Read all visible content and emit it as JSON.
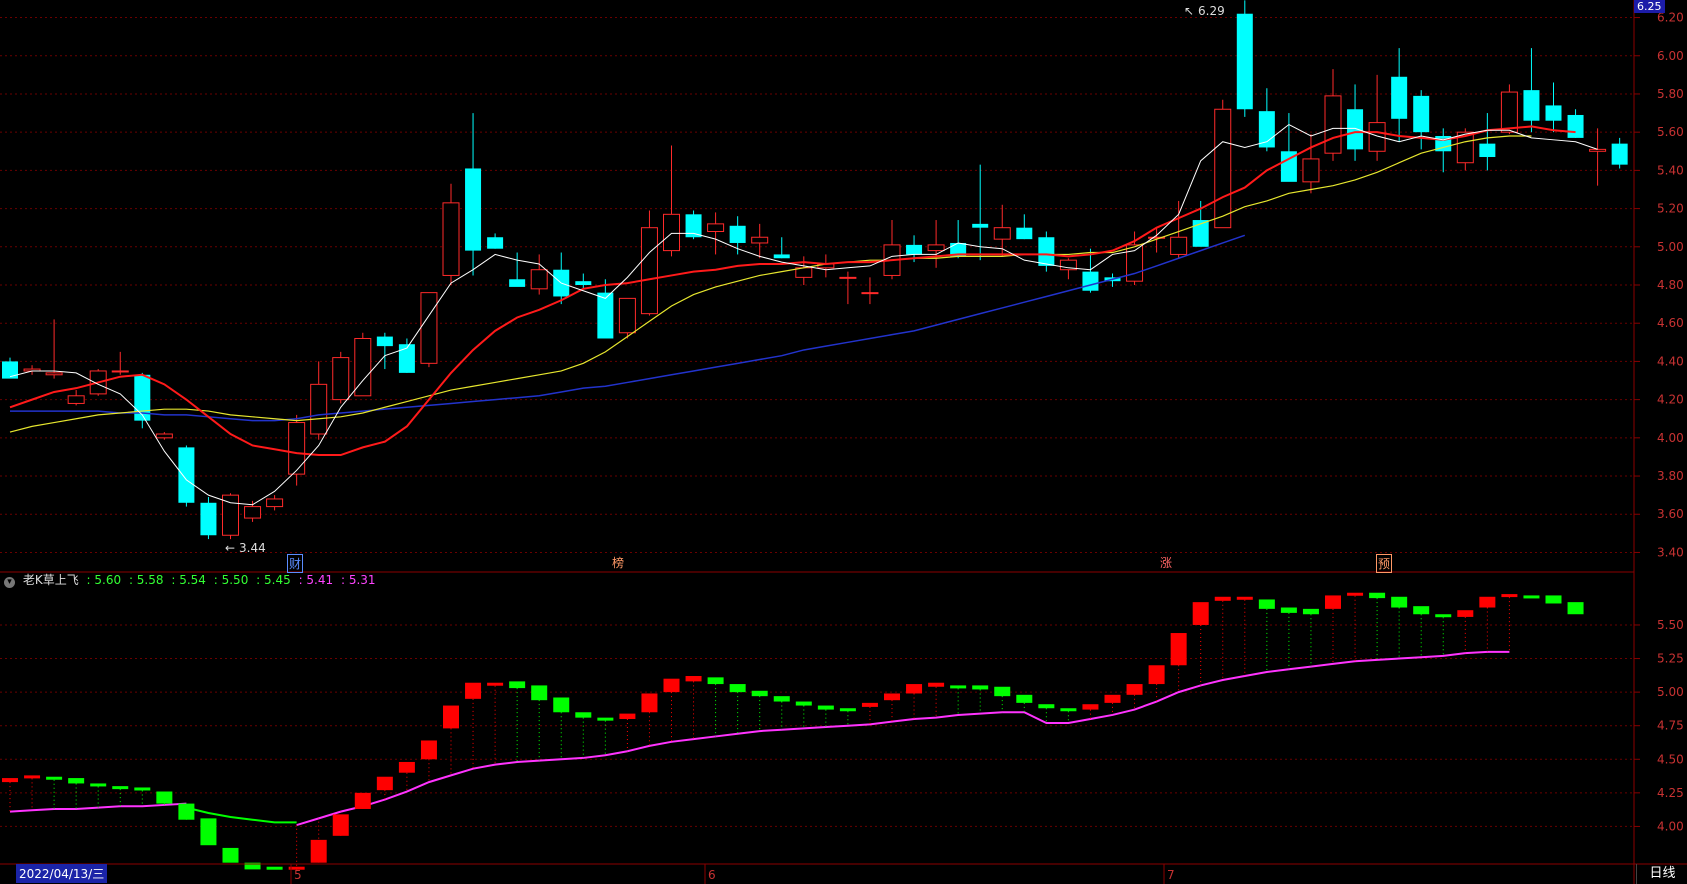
{
  "top_price_tag": "6.25",
  "daily_period_label": "日线",
  "date_label": "2022/04/13/三",
  "month_labels": [
    "5",
    "6",
    "7"
  ],
  "event_markers": [
    {
      "label": "财",
      "color": "#5a8cff"
    },
    {
      "label": "榜",
      "color": "#ff9966"
    },
    {
      "label": "涨",
      "color": "#ff6666"
    },
    {
      "label": "预",
      "color": "#ff9966"
    }
  ],
  "high_annotation": "6.29",
  "low_annotation": "3.44",
  "indicator": {
    "name": "老K草上飞",
    "values": [
      {
        "text": ": 5.60",
        "color": "#33ff33"
      },
      {
        "text": ": 5.58",
        "color": "#33ff33"
      },
      {
        "text": ": 5.54",
        "color": "#33ff33"
      },
      {
        "text": ": 5.50",
        "color": "#33ff33"
      },
      {
        "text": ": 5.45",
        "color": "#33ff33"
      },
      {
        "text": ": 5.41",
        "color": "#ff44ff"
      },
      {
        "text": ": 5.31",
        "color": "#ff44ff"
      }
    ]
  },
  "colors": {
    "up": "#ff2a2a",
    "down": "#00ffff",
    "ma5": "#ffffff",
    "ma10": "#ff1a1a",
    "ma20": "#e6e62e",
    "ma60": "#2233cc",
    "ind_up": "#ff0000",
    "ind_down": "#00ff00",
    "ind_line": "#ff33ff",
    "grid": "#6a0000"
  },
  "chart_data": [
    {
      "type": "candlestick",
      "ylim": [
        3.35,
        6.25
      ],
      "yticks": [
        "6.20",
        "6.00",
        "5.80",
        "5.60",
        "5.40",
        "5.20",
        "5.00",
        "4.80",
        "4.60",
        "4.40",
        "4.20",
        "4.00",
        "3.80",
        "3.60",
        "3.40"
      ],
      "ohlc": [
        [
          4.4,
          4.42,
          4.32,
          4.31
        ],
        [
          4.35,
          4.38,
          4.33,
          4.36
        ],
        [
          4.33,
          4.62,
          4.31,
          4.34
        ],
        [
          4.18,
          4.25,
          4.17,
          4.22
        ],
        [
          4.23,
          4.36,
          4.22,
          4.35
        ],
        [
          4.35,
          4.45,
          4.33,
          4.35
        ],
        [
          4.33,
          4.34,
          4.05,
          4.09
        ],
        [
          4.0,
          4.03,
          3.99,
          4.02
        ],
        [
          3.95,
          3.96,
          3.64,
          3.66
        ],
        [
          3.66,
          3.69,
          3.47,
          3.49
        ],
        [
          3.49,
          3.71,
          3.47,
          3.7
        ],
        [
          3.58,
          3.67,
          3.56,
          3.64
        ],
        [
          3.64,
          3.7,
          3.62,
          3.68
        ],
        [
          3.81,
          4.12,
          3.75,
          4.08
        ],
        [
          4.02,
          4.4,
          3.99,
          4.28
        ],
        [
          4.2,
          4.45,
          4.18,
          4.42
        ],
        [
          4.22,
          4.55,
          4.22,
          4.52
        ],
        [
          4.53,
          4.55,
          4.36,
          4.48
        ],
        [
          4.49,
          4.52,
          4.34,
          4.34
        ],
        [
          4.39,
          4.64,
          4.37,
          4.76
        ],
        [
          4.85,
          5.33,
          4.8,
          5.23
        ],
        [
          5.41,
          5.7,
          4.85,
          4.98
        ],
        [
          5.05,
          5.07,
          4.99,
          4.99
        ],
        [
          4.83,
          4.97,
          4.82,
          4.79
        ],
        [
          4.78,
          4.96,
          4.75,
          4.88
        ],
        [
          4.88,
          4.97,
          4.7,
          4.74
        ],
        [
          4.82,
          4.86,
          4.78,
          4.8
        ],
        [
          4.76,
          4.83,
          4.55,
          4.52
        ],
        [
          4.55,
          4.66,
          4.52,
          4.73
        ],
        [
          4.65,
          5.19,
          4.64,
          5.1
        ],
        [
          4.98,
          5.53,
          4.95,
          5.17
        ],
        [
          5.17,
          5.19,
          5.04,
          5.05
        ],
        [
          5.08,
          5.18,
          4.96,
          5.12
        ],
        [
          5.11,
          5.16,
          4.96,
          5.02
        ],
        [
          5.02,
          5.12,
          4.94,
          5.05
        ],
        [
          4.96,
          5.05,
          4.94,
          4.94
        ],
        [
          4.84,
          4.95,
          4.8,
          4.89
        ],
        [
          4.89,
          4.96,
          4.84,
          4.91
        ],
        [
          4.84,
          4.87,
          4.7,
          4.84
        ],
        [
          4.76,
          4.84,
          4.7,
          4.76
        ],
        [
          4.85,
          5.14,
          4.83,
          5.01
        ],
        [
          5.01,
          5.06,
          4.92,
          4.96
        ],
        [
          4.98,
          5.14,
          4.89,
          5.01
        ],
        [
          5.02,
          5.14,
          4.94,
          4.95
        ],
        [
          5.12,
          5.43,
          4.93,
          5.1
        ],
        [
          5.04,
          5.22,
          4.95,
          5.1
        ],
        [
          5.1,
          5.17,
          5.04,
          5.04
        ],
        [
          5.05,
          5.08,
          4.87,
          4.9
        ],
        [
          4.88,
          4.94,
          4.83,
          4.93
        ],
        [
          4.87,
          4.99,
          4.76,
          4.77
        ],
        [
          4.84,
          4.86,
          4.79,
          4.82
        ],
        [
          4.82,
          5.08,
          4.8,
          5.01
        ],
        [
          5.05,
          5.1,
          4.97,
          5.05
        ],
        [
          4.96,
          5.24,
          4.94,
          5.05
        ],
        [
          5.14,
          5.24,
          5.01,
          5.0
        ],
        [
          5.1,
          5.77,
          5.1,
          5.72
        ],
        [
          6.22,
          6.29,
          5.68,
          5.72
        ],
        [
          5.71,
          5.83,
          5.5,
          5.52
        ],
        [
          5.5,
          5.7,
          5.38,
          5.34
        ],
        [
          5.34,
          5.59,
          5.28,
          5.46
        ],
        [
          5.49,
          5.93,
          5.45,
          5.79
        ],
        [
          5.72,
          5.85,
          5.45,
          5.51
        ],
        [
          5.5,
          5.9,
          5.45,
          5.65
        ],
        [
          5.89,
          6.04,
          5.55,
          5.67
        ],
        [
          5.79,
          5.82,
          5.51,
          5.6
        ],
        [
          5.58,
          5.62,
          5.39,
          5.5
        ],
        [
          5.44,
          5.62,
          5.4,
          5.6
        ],
        [
          5.54,
          5.7,
          5.4,
          5.47
        ],
        [
          5.6,
          5.85,
          5.59,
          5.81
        ],
        [
          5.82,
          6.04,
          5.6,
          5.66
        ],
        [
          5.74,
          5.86,
          5.6,
          5.66
        ],
        [
          5.69,
          5.72,
          5.57,
          5.57
        ],
        [
          5.5,
          5.62,
          5.32,
          5.51
        ],
        [
          5.54,
          5.57,
          5.41,
          5.43
        ]
      ],
      "ma5": [
        4.32,
        4.35,
        4.35,
        4.34,
        4.28,
        4.23,
        4.12,
        3.93,
        3.78,
        3.7,
        3.66,
        3.65,
        3.72,
        3.83,
        3.96,
        4.16,
        4.3,
        4.43,
        4.47,
        4.64,
        4.81,
        4.88,
        4.96,
        4.93,
        4.91,
        4.81,
        4.77,
        4.73,
        4.84,
        4.97,
        5.07,
        5.07,
        5.04,
        4.99,
        4.95,
        4.92,
        4.9,
        4.88,
        4.89,
        4.9,
        4.95,
        4.96,
        4.96,
        5.02,
        5.0,
        4.99,
        4.93,
        4.91,
        4.89,
        4.88,
        4.96,
        4.98,
        5.06,
        5.17,
        5.45,
        5.55,
        5.52,
        5.55,
        5.64,
        5.58,
        5.62,
        5.62,
        5.58,
        5.55,
        5.58,
        5.56,
        5.59,
        5.61,
        5.61,
        5.57,
        5.56,
        5.55,
        5.51
      ],
      "ma10": [
        4.16,
        4.2,
        4.24,
        4.26,
        4.29,
        4.32,
        4.33,
        4.28,
        4.2,
        4.11,
        4.02,
        3.96,
        3.94,
        3.92,
        3.91,
        3.91,
        3.95,
        3.98,
        4.06,
        4.2,
        4.34,
        4.46,
        4.56,
        4.63,
        4.67,
        4.72,
        4.78,
        4.8,
        4.81,
        4.83,
        4.85,
        4.87,
        4.88,
        4.9,
        4.91,
        4.91,
        4.92,
        4.91,
        4.92,
        4.92,
        4.93,
        4.94,
        4.95,
        4.96,
        4.96,
        4.96,
        4.96,
        4.96,
        4.95,
        4.96,
        4.98,
        5.03,
        5.1,
        5.15,
        5.2,
        5.26,
        5.31,
        5.4,
        5.46,
        5.52,
        5.57,
        5.6,
        5.6,
        5.58,
        5.57,
        5.56,
        5.58,
        5.61,
        5.62,
        5.63,
        5.61,
        5.6
      ],
      "ma20": [
        4.03,
        4.06,
        4.08,
        4.1,
        4.12,
        4.13,
        4.14,
        4.15,
        4.15,
        4.14,
        4.12,
        4.11,
        4.1,
        4.09,
        4.1,
        4.11,
        4.13,
        4.16,
        4.19,
        4.22,
        4.25,
        4.27,
        4.29,
        4.31,
        4.33,
        4.35,
        4.39,
        4.45,
        4.53,
        4.61,
        4.69,
        4.75,
        4.79,
        4.82,
        4.85,
        4.87,
        4.89,
        4.91,
        4.92,
        4.93,
        4.93,
        4.94,
        4.94,
        4.95,
        4.95,
        4.95,
        4.96,
        4.96,
        4.96,
        4.97,
        4.97,
        5.0,
        5.04,
        5.08,
        5.12,
        5.16,
        5.21,
        5.24,
        5.28,
        5.3,
        5.32,
        5.35,
        5.39,
        5.44,
        5.49,
        5.52,
        5.55,
        5.57,
        5.58,
        5.58
      ],
      "ma60": [
        4.14,
        4.14,
        4.14,
        4.14,
        4.14,
        4.13,
        4.13,
        4.12,
        4.12,
        4.11,
        4.1,
        4.09,
        4.09,
        4.1,
        4.12,
        4.13,
        4.14,
        4.15,
        4.16,
        4.17,
        4.18,
        4.19,
        4.2,
        4.21,
        4.22,
        4.24,
        4.26,
        4.27,
        4.29,
        4.31,
        4.33,
        4.35,
        4.37,
        4.39,
        4.41,
        4.43,
        4.46,
        4.48,
        4.5,
        4.52,
        4.54,
        4.56,
        4.59,
        4.62,
        4.65,
        4.68,
        4.71,
        4.74,
        4.77,
        4.8,
        4.83,
        4.86,
        4.9,
        4.94,
        4.98,
        5.02,
        5.06
      ]
    },
    {
      "type": "bar",
      "ylim": [
        3.75,
        5.82
      ],
      "yticks": [
        "5.50",
        "5.25",
        "5.00",
        "4.75",
        "4.50",
        "4.25",
        "4.00"
      ],
      "blocks": [
        [
          4.33,
          4.36
        ],
        [
          4.36,
          4.38
        ],
        [
          4.36,
          4.37
        ],
        [
          4.32,
          4.36
        ],
        [
          4.3,
          4.32
        ],
        [
          4.29,
          4.3
        ],
        [
          4.27,
          4.29
        ],
        [
          4.17,
          4.26
        ],
        [
          4.05,
          4.17
        ],
        [
          3.86,
          4.06
        ],
        [
          3.73,
          3.84
        ],
        [
          3.68,
          3.73
        ],
        [
          3.7,
          3.7
        ],
        [
          3.7,
          3.7
        ],
        [
          3.73,
          3.9
        ],
        [
          3.93,
          4.09
        ],
        [
          4.13,
          4.25
        ],
        [
          4.27,
          4.37
        ],
        [
          4.4,
          4.48
        ],
        [
          4.5,
          4.64
        ],
        [
          4.73,
          4.9
        ],
        [
          4.95,
          5.07
        ],
        [
          5.05,
          5.07
        ],
        [
          5.03,
          5.08
        ],
        [
          4.94,
          5.05
        ],
        [
          4.85,
          4.96
        ],
        [
          4.81,
          4.85
        ],
        [
          4.79,
          4.81
        ],
        [
          4.8,
          4.84
        ],
        [
          4.85,
          4.99
        ],
        [
          5.0,
          5.1
        ],
        [
          5.08,
          5.12
        ],
        [
          5.06,
          5.11
        ],
        [
          5.0,
          5.06
        ],
        [
          4.97,
          5.01
        ],
        [
          4.93,
          4.97
        ],
        [
          4.9,
          4.93
        ],
        [
          4.87,
          4.9
        ],
        [
          4.86,
          4.88
        ],
        [
          4.89,
          4.92
        ],
        [
          4.94,
          4.99
        ],
        [
          4.99,
          5.06
        ],
        [
          5.04,
          5.07
        ],
        [
          5.04,
          5.05
        ],
        [
          5.02,
          5.05
        ],
        [
          4.97,
          5.04
        ],
        [
          4.92,
          4.98
        ],
        [
          4.88,
          4.91
        ],
        [
          4.87,
          4.88
        ],
        [
          4.87,
          4.91
        ],
        [
          4.92,
          4.98
        ],
        [
          4.98,
          5.06
        ],
        [
          5.06,
          5.2
        ],
        [
          5.2,
          5.44
        ],
        [
          5.5,
          5.67
        ],
        [
          5.68,
          5.71
        ],
        [
          5.69,
          5.71
        ],
        [
          5.62,
          5.69
        ],
        [
          5.59,
          5.63
        ],
        [
          5.58,
          5.62
        ],
        [
          5.62,
          5.72
        ],
        [
          5.72,
          5.74
        ],
        [
          5.7,
          5.74
        ],
        [
          5.63,
          5.71
        ],
        [
          5.58,
          5.64
        ],
        [
          5.56,
          5.58
        ],
        [
          5.56,
          5.61
        ],
        [
          5.63,
          5.71
        ],
        [
          5.71,
          5.73
        ],
        [
          5.71,
          5.72
        ],
        [
          5.66,
          5.72
        ],
        [
          5.58,
          5.67
        ]
      ],
      "line": [
        4.11,
        4.12,
        4.13,
        4.13,
        4.14,
        4.15,
        4.15,
        4.16,
        4.17,
        null,
        null,
        null,
        null,
        4.01,
        4.06,
        4.11,
        4.15,
        4.2,
        4.26,
        4.33,
        4.38,
        4.43,
        4.46,
        4.48,
        4.49,
        4.5,
        4.51,
        4.53,
        4.56,
        4.6,
        4.63,
        4.65,
        4.67,
        4.69,
        4.71,
        4.72,
        4.73,
        4.74,
        4.75,
        4.76,
        4.78,
        4.8,
        4.81,
        4.83,
        4.84,
        4.85,
        4.85,
        4.77,
        4.77,
        4.8,
        4.83,
        4.87,
        4.93,
        5.0,
        5.05,
        5.09,
        5.12,
        5.15,
        5.17,
        5.19,
        5.21,
        5.23,
        5.24,
        5.25,
        5.26,
        5.27,
        5.29,
        5.3,
        5.3
      ],
      "line_green": [
        4.14,
        4.1,
        4.07,
        4.05,
        4.03,
        4.03
      ]
    }
  ]
}
